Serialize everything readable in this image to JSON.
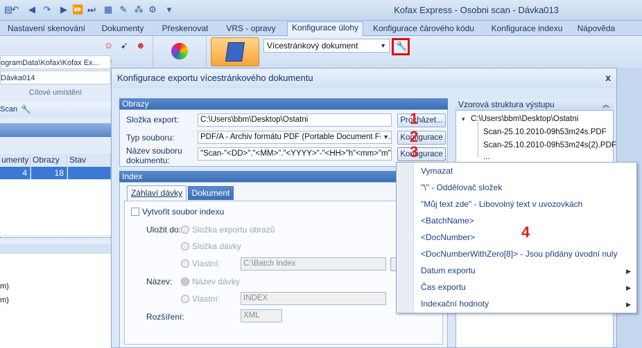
{
  "window": {
    "title": "Kofax Express - Osobni scan - Dávka013"
  },
  "tabs": [
    "Nastavení skenování",
    "Dokumenty",
    "Přeskenovat",
    "VRS - opravy",
    "Konfigurace úlohy",
    "Konfigurace čárového kódu",
    "Konfigurace indexu",
    "Nápověda"
  ],
  "ribbon": {
    "doc_type": "Vícestránkový dokument"
  },
  "left": {
    "path": "ogramData\\Kofax\\Kofax Ex...",
    "batch": "Dávka014",
    "target_label": "Cílové umístění",
    "scan_label": "Scan",
    "grid_headers": [
      "umenty",
      "Obrazy",
      "Stav"
    ],
    "grid_row": [
      "4",
      "18",
      ""
    ],
    "list_items": [
      "m)",
      "m)"
    ]
  },
  "dialog": {
    "title": "Konfigurace exportu vícestránkového dokumentu",
    "images_group": "Obrazy",
    "export_folder_label": "Složka export:",
    "export_folder_value": "C:\\Users\\bbm\\Desktop\\Ostatni",
    "browse_button": "Procházet...",
    "file_type_label": "Typ souboru:",
    "file_type_value": "PDF/A - Archiv formátu PDF (Portable Document Fo...",
    "config_button_1": "Konfigurace",
    "doc_name_label_1": "Název souboru",
    "doc_name_label_2": "dokumentu:",
    "doc_name_value": "\"Scan-\"<DD>\".\"<MM>\".\"<YYYY>\"-\"<HH>\"h\"<mm>\"m\"<",
    "config_button_2": "Konfigurace",
    "index_group": "Index",
    "subtab_header": "Záhlaví dávky",
    "subtab_document": "Dokument",
    "create_index_label": "Vytvořit soubor indexu",
    "save_to_label": "Uložit do:",
    "radio_export_folder": "Složka exportu obrazů",
    "radio_batch_folder": "Složka dávky",
    "radio_custom": "Vlastní:",
    "custom_path": "C:\\Batch Index",
    "name_label": "Název:",
    "radio_batch_name": "Název dávky",
    "radio_custom_name": "Vlastní:",
    "custom_name": "INDEX",
    "extension_label": "Rozšíření:",
    "extension_value": "XML",
    "preview_group": "Vzorová struktura výstupu",
    "tree_root": "C:\\Users\\bbm\\Desktop\\Ostatni",
    "tree_file_1": "Scan-25.10.2010-09h53m24s.PDF",
    "tree_file_2": "Scan-25.10.2010-09h53m24s(2).PDF",
    "tree_more": "...",
    "close": "x"
  },
  "markers": [
    "1",
    "2",
    "3",
    "4"
  ],
  "menu": {
    "items": [
      "Vymazat",
      "\"\\\" - Oddělovač složek",
      "\"Můj text zde\" - Libovolný text v uvozovkách",
      "<BatchName>",
      "<DocNumber>",
      "<DocNumberWithZero[8]> - Jsou přidány úvodní nuly",
      "Datum exportu",
      "Čas exportu",
      "Indexační hodnoty"
    ]
  },
  "colors": {
    "accent": "#3b6fb5",
    "marker": "#e02020",
    "selection": "#3a79d4"
  }
}
